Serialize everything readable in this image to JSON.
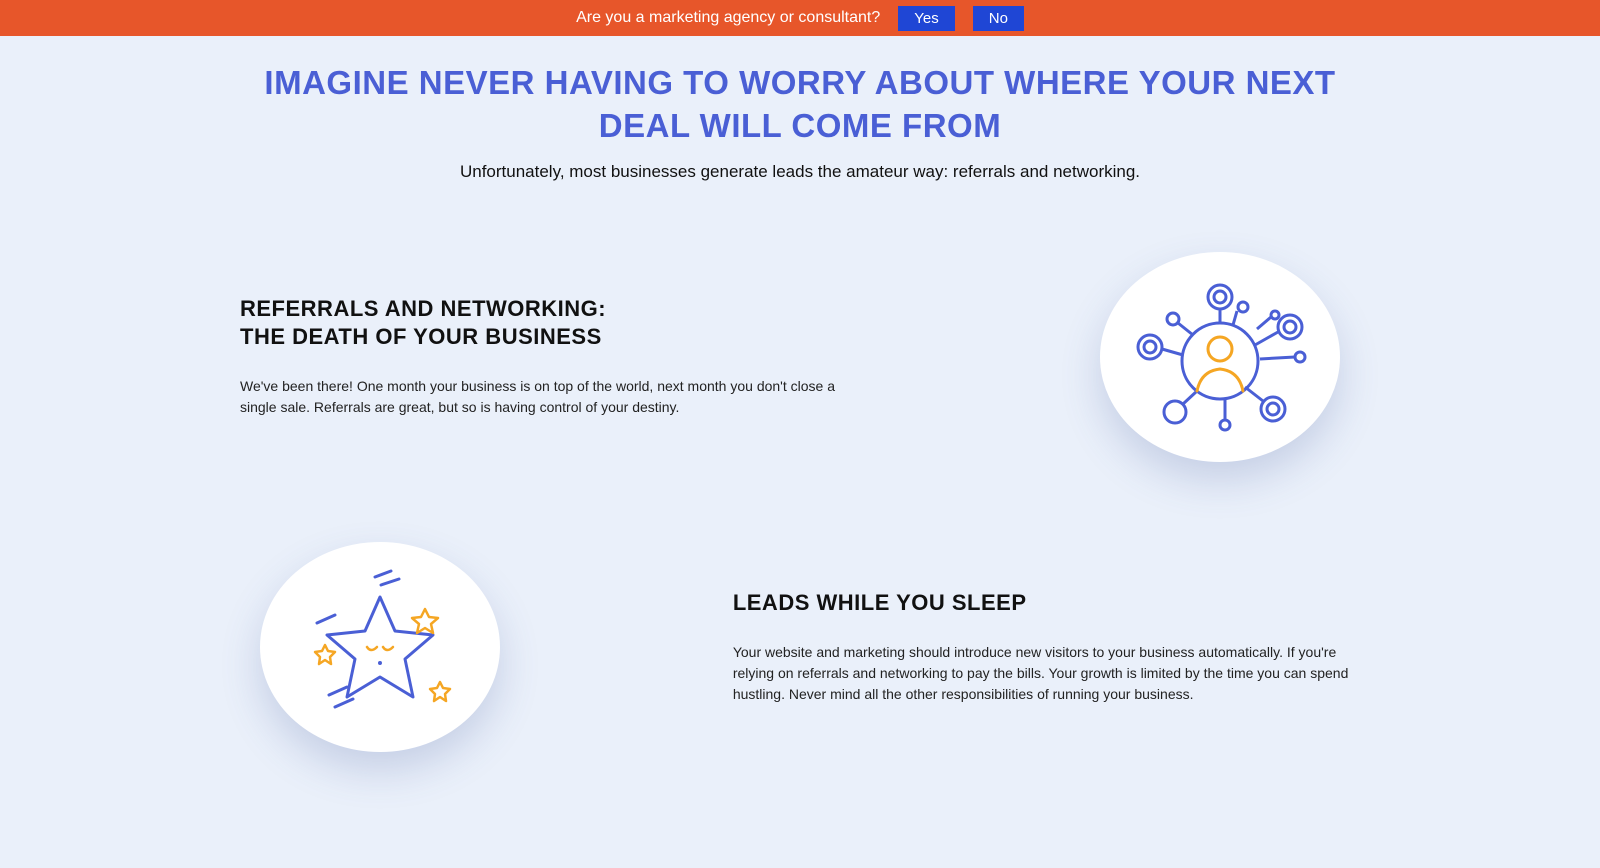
{
  "topbar": {
    "question": "Are you a marketing agency or consultant?",
    "yes": "Yes",
    "no": "No"
  },
  "hero": {
    "title": "IMAGINE NEVER HAVING TO WORRY ABOUT WHERE YOUR NEXT DEAL WILL COME FROM",
    "subtitle": "Unfortunately, most businesses generate leads the amateur way: referrals and networking."
  },
  "sections": [
    {
      "heading_line1": "REFERRALS AND NETWORKING:",
      "heading_line2": "THE DEATH OF YOUR BUSINESS",
      "body": "We've been there! One month your business is on top of the world, next month you don't close a single sale. Referrals are great, but so is having control of your destiny."
    },
    {
      "heading": "LEADS WHILE YOU SLEEP",
      "body": "Your website and marketing should introduce new visitors to your business automatically. If you're relying on referrals and networking to pay the bills. Your growth is limited by the time you can spend hustling. Never mind all the other responsibilities of running your business."
    }
  ]
}
